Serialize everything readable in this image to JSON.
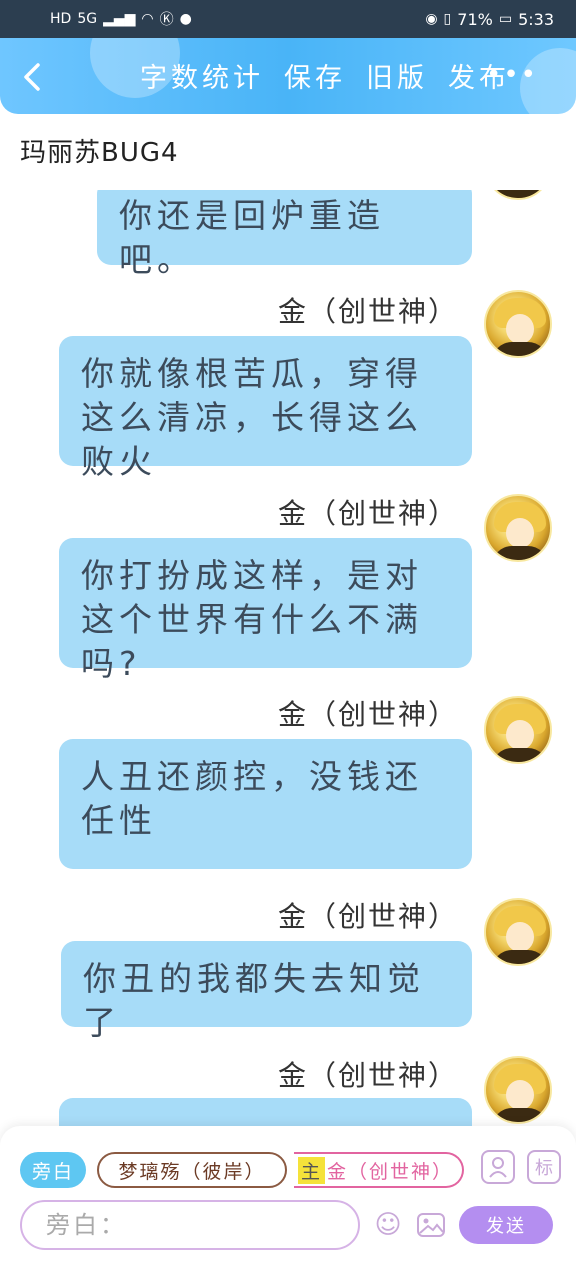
{
  "status_bar": {
    "left_icons": [
      "HD",
      "5G",
      "signal-icon",
      "wifi-icon",
      "k-icon",
      "wechat-icon"
    ],
    "battery": "71%",
    "time": "5:33"
  },
  "nav": {
    "actions": [
      "字数统计",
      "保存",
      "旧版",
      "发布"
    ],
    "more": "•••"
  },
  "doc_title": "玛丽苏BUG4",
  "messages": [
    {
      "speaker": "",
      "text": "你还是回炉重造吧。"
    },
    {
      "speaker": "金（创世神）",
      "text": "你就像根苦瓜，穿得这么清凉，长得这么败火"
    },
    {
      "speaker": "金（创世神）",
      "text": "你打扮成这样，是对这个世界有什么不满吗?"
    },
    {
      "speaker": "金（创世神）",
      "text": "人丑还颜控，没钱还任性"
    },
    {
      "speaker": "金（创世神）",
      "text": "你丑的我都失去知觉了"
    },
    {
      "speaker": "金（创世神）",
      "text": ""
    }
  ],
  "input": {
    "chip_aside": "旁白",
    "chip_role1": "梦璃殇（彼岸）",
    "chip_main": "主",
    "chip_role2": "金（创世神）",
    "icon_mark": "标",
    "placeholder": "旁白：",
    "send": "发送"
  }
}
